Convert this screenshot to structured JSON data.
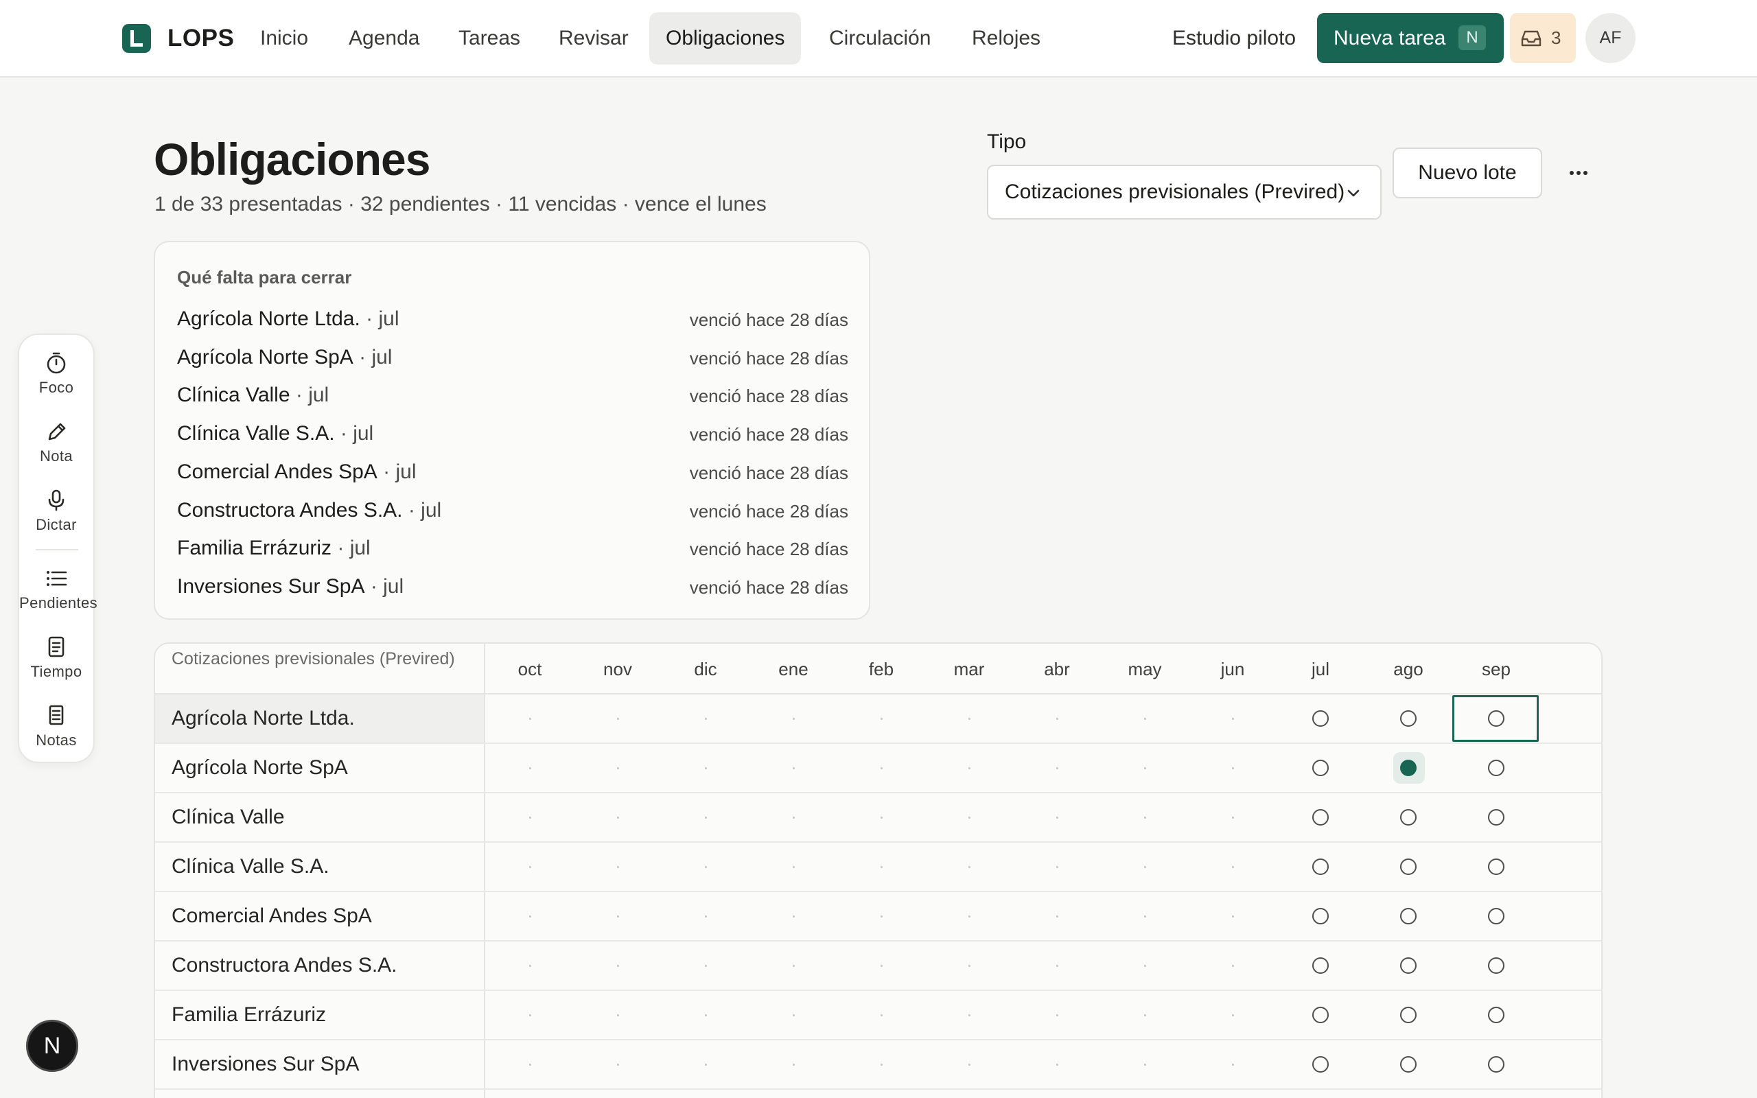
{
  "app": {
    "logo_letter": "L",
    "name": "LOPS",
    "nav": [
      {
        "label": "Inicio",
        "active": false
      },
      {
        "label": "Agenda",
        "active": false
      },
      {
        "label": "Tareas",
        "active": false
      },
      {
        "label": "Revisar",
        "active": false
      },
      {
        "label": "Obligaciones",
        "active": true
      },
      {
        "label": "Circulación",
        "active": false
      },
      {
        "label": "Relojes",
        "active": false
      }
    ],
    "studio": "Estudio piloto",
    "new_task_label": "Nueva tarea",
    "new_task_shortcut": "N",
    "inbox_count": "3",
    "avatar_initials": "AF",
    "accent_color": "#176552"
  },
  "rail": {
    "items": [
      {
        "label": "Foco",
        "icon": "timer-icon"
      },
      {
        "label": "Nota",
        "icon": "pencil-icon"
      },
      {
        "label": "Dictar",
        "icon": "microphone-icon"
      },
      {
        "label": "Pendientes",
        "icon": "list-icon"
      },
      {
        "label": "Tiempo",
        "icon": "document-icon"
      },
      {
        "label": "Notas",
        "icon": "notes-icon"
      }
    ],
    "assistant_badge": "N"
  },
  "header": {
    "title": "Obligaciones",
    "subtitle": "1 de 33 presentadas · 32 pendientes · 11 vencidas · vence el lunes",
    "tipo_label": "Tipo",
    "tipo_value": "Cotizaciones previsionales (Previred)",
    "new_batch_label": "Nuevo lote",
    "more_label": "···"
  },
  "pending": {
    "title": "Qué falta para cerrar",
    "items": [
      {
        "name": "Agrícola Norte Ltda.",
        "period": " · jul",
        "due": "venció hace 28 días"
      },
      {
        "name": "Agrícola Norte SpA",
        "period": " · jul",
        "due": "venció hace 28 días"
      },
      {
        "name": "Clínica Valle",
        "period": " · jul",
        "due": "venció hace 28 días"
      },
      {
        "name": "Clínica Valle S.A.",
        "period": " · jul",
        "due": "venció hace 28 días"
      },
      {
        "name": "Comercial Andes SpA",
        "period": " · jul",
        "due": "venció hace 28 días"
      },
      {
        "name": "Constructora Andes S.A.",
        "period": " · jul",
        "due": "venció hace 28 días"
      },
      {
        "name": "Familia Errázuriz",
        "period": " · jul",
        "due": "venció hace 28 días"
      },
      {
        "name": "Inversiones Sur SpA",
        "period": " · jul",
        "due": "venció hace 28 días"
      }
    ]
  },
  "grid": {
    "corner_label": "Cotizaciones previsionales (Previred)",
    "months": [
      "oct",
      "nov",
      "dic",
      "ene",
      "feb",
      "mar",
      "abr",
      "may",
      "jun",
      "jul",
      "ago",
      "sep"
    ],
    "rows": [
      {
        "name": "Agrícola Norte Ltda.",
        "selected": true,
        "cells": [
          "none",
          "none",
          "none",
          "none",
          "none",
          "none",
          "none",
          "none",
          "none",
          "pending",
          "pending",
          "pending"
        ],
        "focus_month": "sep"
      },
      {
        "name": "Agrícola Norte SpA",
        "selected": false,
        "cells": [
          "none",
          "none",
          "none",
          "none",
          "none",
          "none",
          "none",
          "none",
          "none",
          "pending",
          "filed",
          "pending"
        ]
      },
      {
        "name": "Clínica Valle",
        "selected": false,
        "cells": [
          "none",
          "none",
          "none",
          "none",
          "none",
          "none",
          "none",
          "none",
          "none",
          "pending",
          "pending",
          "pending"
        ]
      },
      {
        "name": "Clínica Valle S.A.",
        "selected": false,
        "cells": [
          "none",
          "none",
          "none",
          "none",
          "none",
          "none",
          "none",
          "none",
          "none",
          "pending",
          "pending",
          "pending"
        ]
      },
      {
        "name": "Comercial Andes SpA",
        "selected": false,
        "cells": [
          "none",
          "none",
          "none",
          "none",
          "none",
          "none",
          "none",
          "none",
          "none",
          "pending",
          "pending",
          "pending"
        ]
      },
      {
        "name": "Constructora Andes S.A.",
        "selected": false,
        "cells": [
          "none",
          "none",
          "none",
          "none",
          "none",
          "none",
          "none",
          "none",
          "none",
          "pending",
          "pending",
          "pending"
        ]
      },
      {
        "name": "Familia Errázuriz",
        "selected": false,
        "cells": [
          "none",
          "none",
          "none",
          "none",
          "none",
          "none",
          "none",
          "none",
          "none",
          "pending",
          "pending",
          "pending"
        ]
      },
      {
        "name": "Inversiones Sur SpA",
        "selected": false,
        "cells": [
          "none",
          "none",
          "none",
          "none",
          "none",
          "none",
          "none",
          "none",
          "none",
          "pending",
          "pending",
          "pending"
        ]
      }
    ]
  }
}
